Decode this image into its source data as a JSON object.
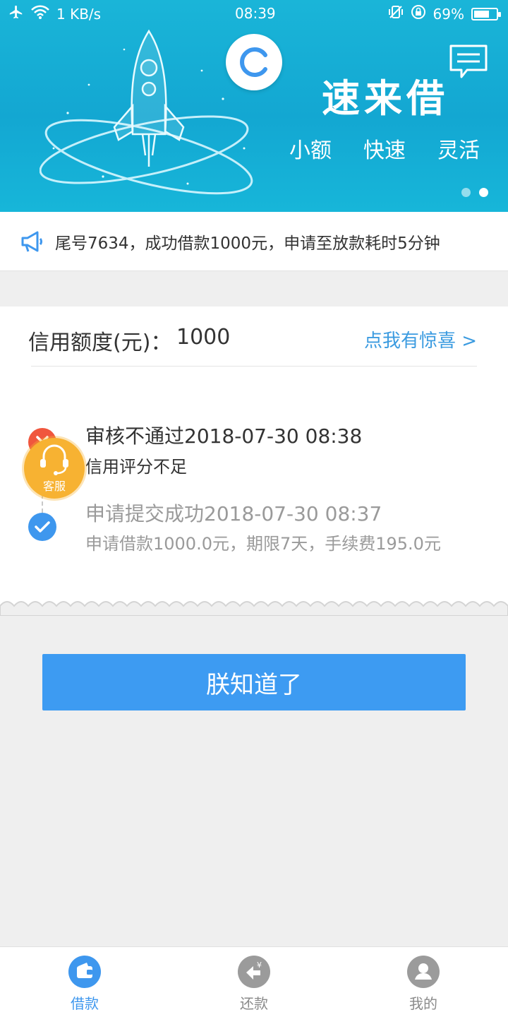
{
  "status_bar": {
    "network": "1 KB/s",
    "time": "08:39",
    "battery": "69%",
    "battery_level": 0.69
  },
  "banner": {
    "brand": "速来借",
    "tags": [
      "小额",
      "快速",
      "灵活"
    ]
  },
  "notice": {
    "text": "尾号7634，成功借款1000元，申请至放款耗时5分钟"
  },
  "credit": {
    "label": "信用额度(元)：",
    "value": "1000",
    "link": "点我有惊喜 >"
  },
  "steps": [
    {
      "title": "审核不通过2018-07-30 08:38",
      "desc": "信用评分不足",
      "status": "failed"
    },
    {
      "title": "申请提交成功2018-07-30 08:37",
      "desc": "申请借款1000.0元，期限7天，手续费195.0元",
      "status": "done"
    }
  ],
  "service": {
    "label": "客服"
  },
  "button": {
    "label": "朕知道了"
  },
  "tabs": [
    {
      "label": "借款",
      "icon": "wallet-icon",
      "active": true
    },
    {
      "label": "还款",
      "icon": "repay-icon",
      "active": false
    },
    {
      "label": "我的",
      "icon": "user-icon",
      "active": false
    }
  ],
  "colors": {
    "accent": "#3e97ee",
    "banner": "#13a7d2",
    "fail": "#f0563d",
    "service": "#f7b232"
  }
}
